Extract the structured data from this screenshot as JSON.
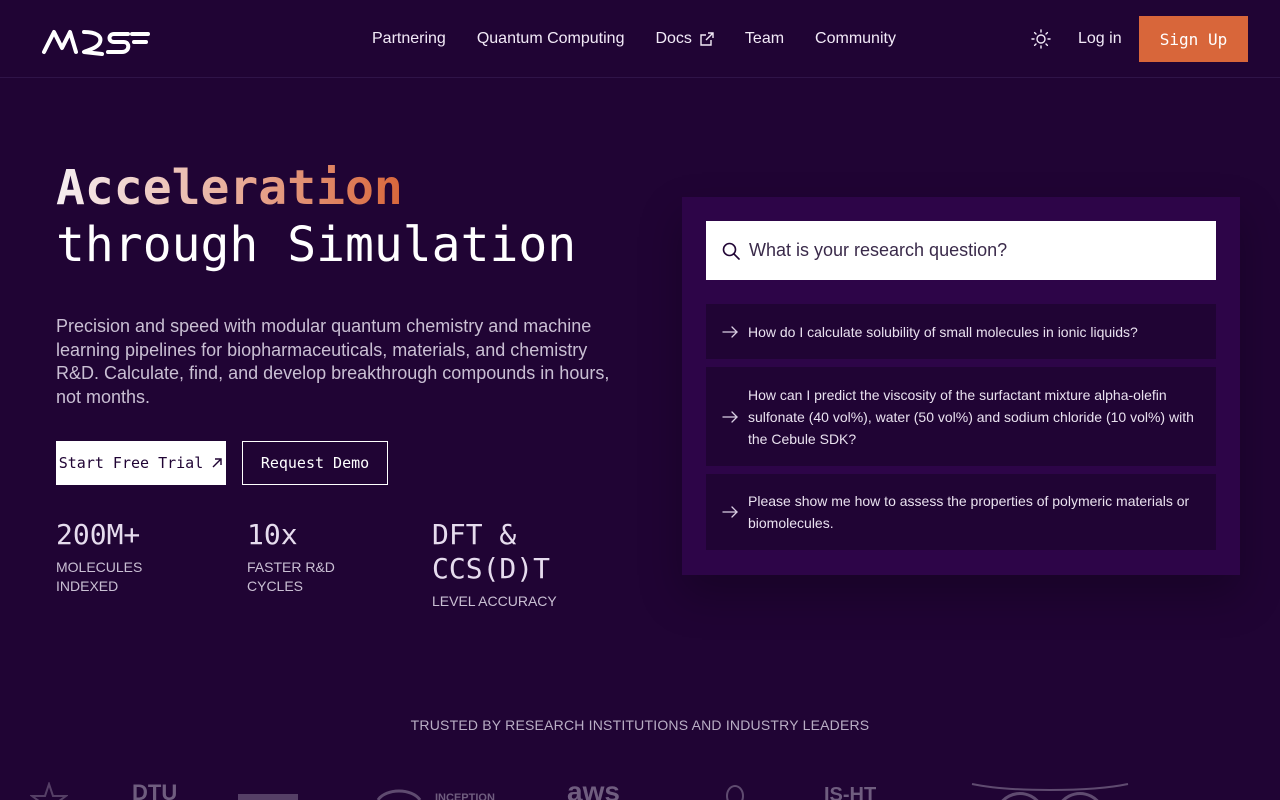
{
  "nav": {
    "links": [
      {
        "label": "Partnering"
      },
      {
        "label": "Quantum Computing"
      },
      {
        "label": "Docs"
      },
      {
        "label": "Team"
      },
      {
        "label": "Community"
      }
    ],
    "login_label": "Log in",
    "signup_label": "Sign Up"
  },
  "hero": {
    "title_highlight": "Acceleration",
    "title_rest": "through Simulation",
    "description": "Precision and speed with modular quantum chemistry and machine learning pipelines for biopharmaceuticals, materials, and chemistry R&D. Calculate, find, and develop breakthrough compounds in hours, not months.",
    "trial_label": "Start Free Trial",
    "demo_label": "Request Demo",
    "stats": [
      {
        "value": "200M+",
        "label": "Molecules indexed"
      },
      {
        "value": "10x",
        "label": "Faster R&D cycles"
      },
      {
        "value": "DFT & CCS(D)T",
        "label": "Level accuracy"
      }
    ]
  },
  "search": {
    "placeholder": "What is your research question?",
    "suggestions": [
      {
        "text": "How do I calculate solubility of small molecules in ionic liquids?"
      },
      {
        "text": "How can I predict the viscosity of the surfactant mixture alpha-olefin sulfonate (40 vol%), water (50 vol%) and sodium chloride (10 vol%) with the Cebule SDK?"
      },
      {
        "text": "Please show me how to assess the properties of polymeric materials or biomolecules."
      }
    ]
  },
  "trusted": {
    "heading": "TRUSTED BY RESEARCH INSTITUTIONS AND INDUSTRY LEADERS",
    "logos": [
      {
        "name": "DTU"
      },
      {
        "name": "INCEPTION"
      },
      {
        "name": "aws"
      },
      {
        "name": "IS-HT"
      }
    ]
  },
  "colors": {
    "background": "#200434",
    "panel": "#2d0548",
    "accent": "#d8663a"
  },
  "icons": {
    "external": "external-link-icon",
    "theme": "sun-icon",
    "search": "search-icon",
    "suggestion": "arrow-right-icon"
  }
}
